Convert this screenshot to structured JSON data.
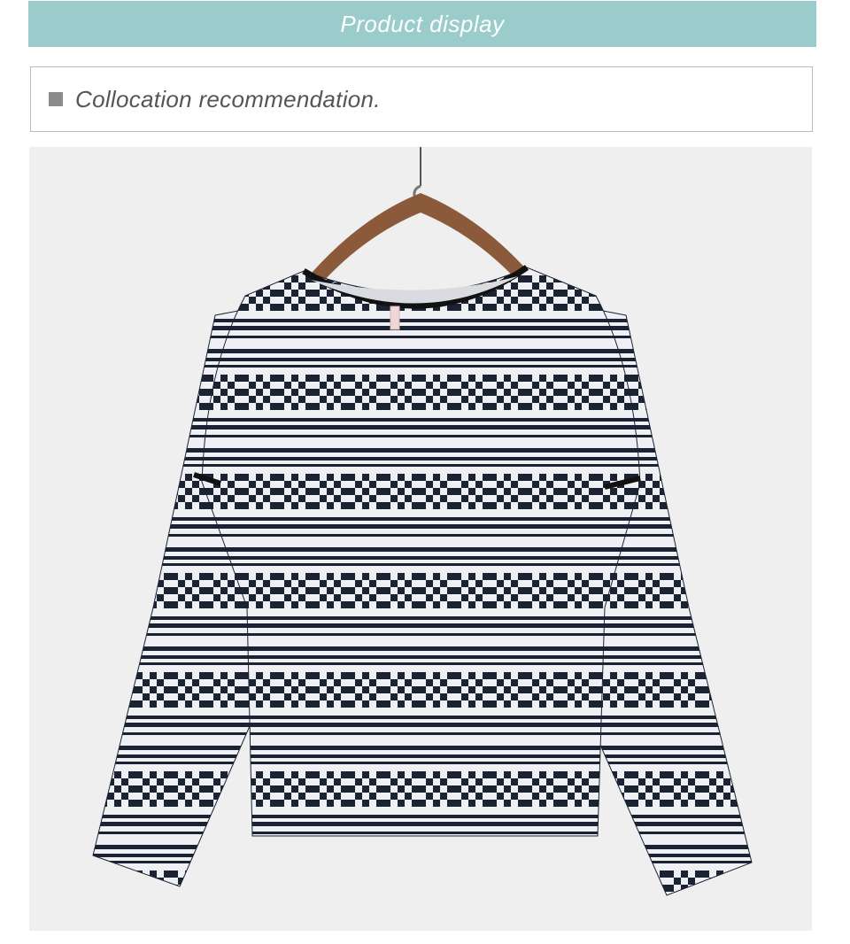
{
  "banner": {
    "title": "Product display",
    "color": "#99cccb"
  },
  "section": {
    "label": "Collocation recommendation."
  },
  "photo": {
    "subject": "striped-long-sleeve-top-on-hanger-icon",
    "background": "#efefef"
  }
}
